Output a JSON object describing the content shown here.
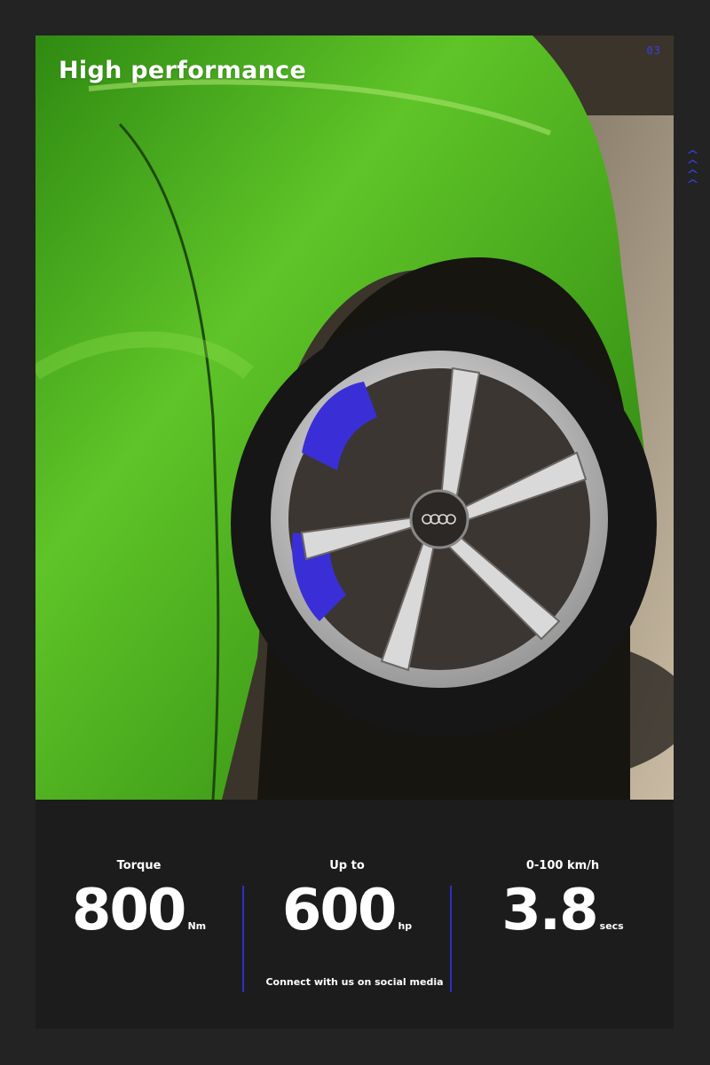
{
  "page": {
    "title": "High performance",
    "page_number": "03",
    "scroll_up_icon": "chevron-up-stack-icon",
    "accent_color": "#3b40e8"
  },
  "stats": [
    {
      "label": "Torque",
      "value": "800",
      "unit": "Nm"
    },
    {
      "label": "Up to",
      "value": "600",
      "unit": "hp"
    },
    {
      "label": "0-100 km/h",
      "value": "3.8",
      "unit": "secs"
    }
  ],
  "footer": {
    "social_text": "Connect with us on social media"
  },
  "image": {
    "subject": "car-wheel-photo",
    "body_color": "#4caf1f",
    "caliper_color": "#3a2fd6"
  }
}
